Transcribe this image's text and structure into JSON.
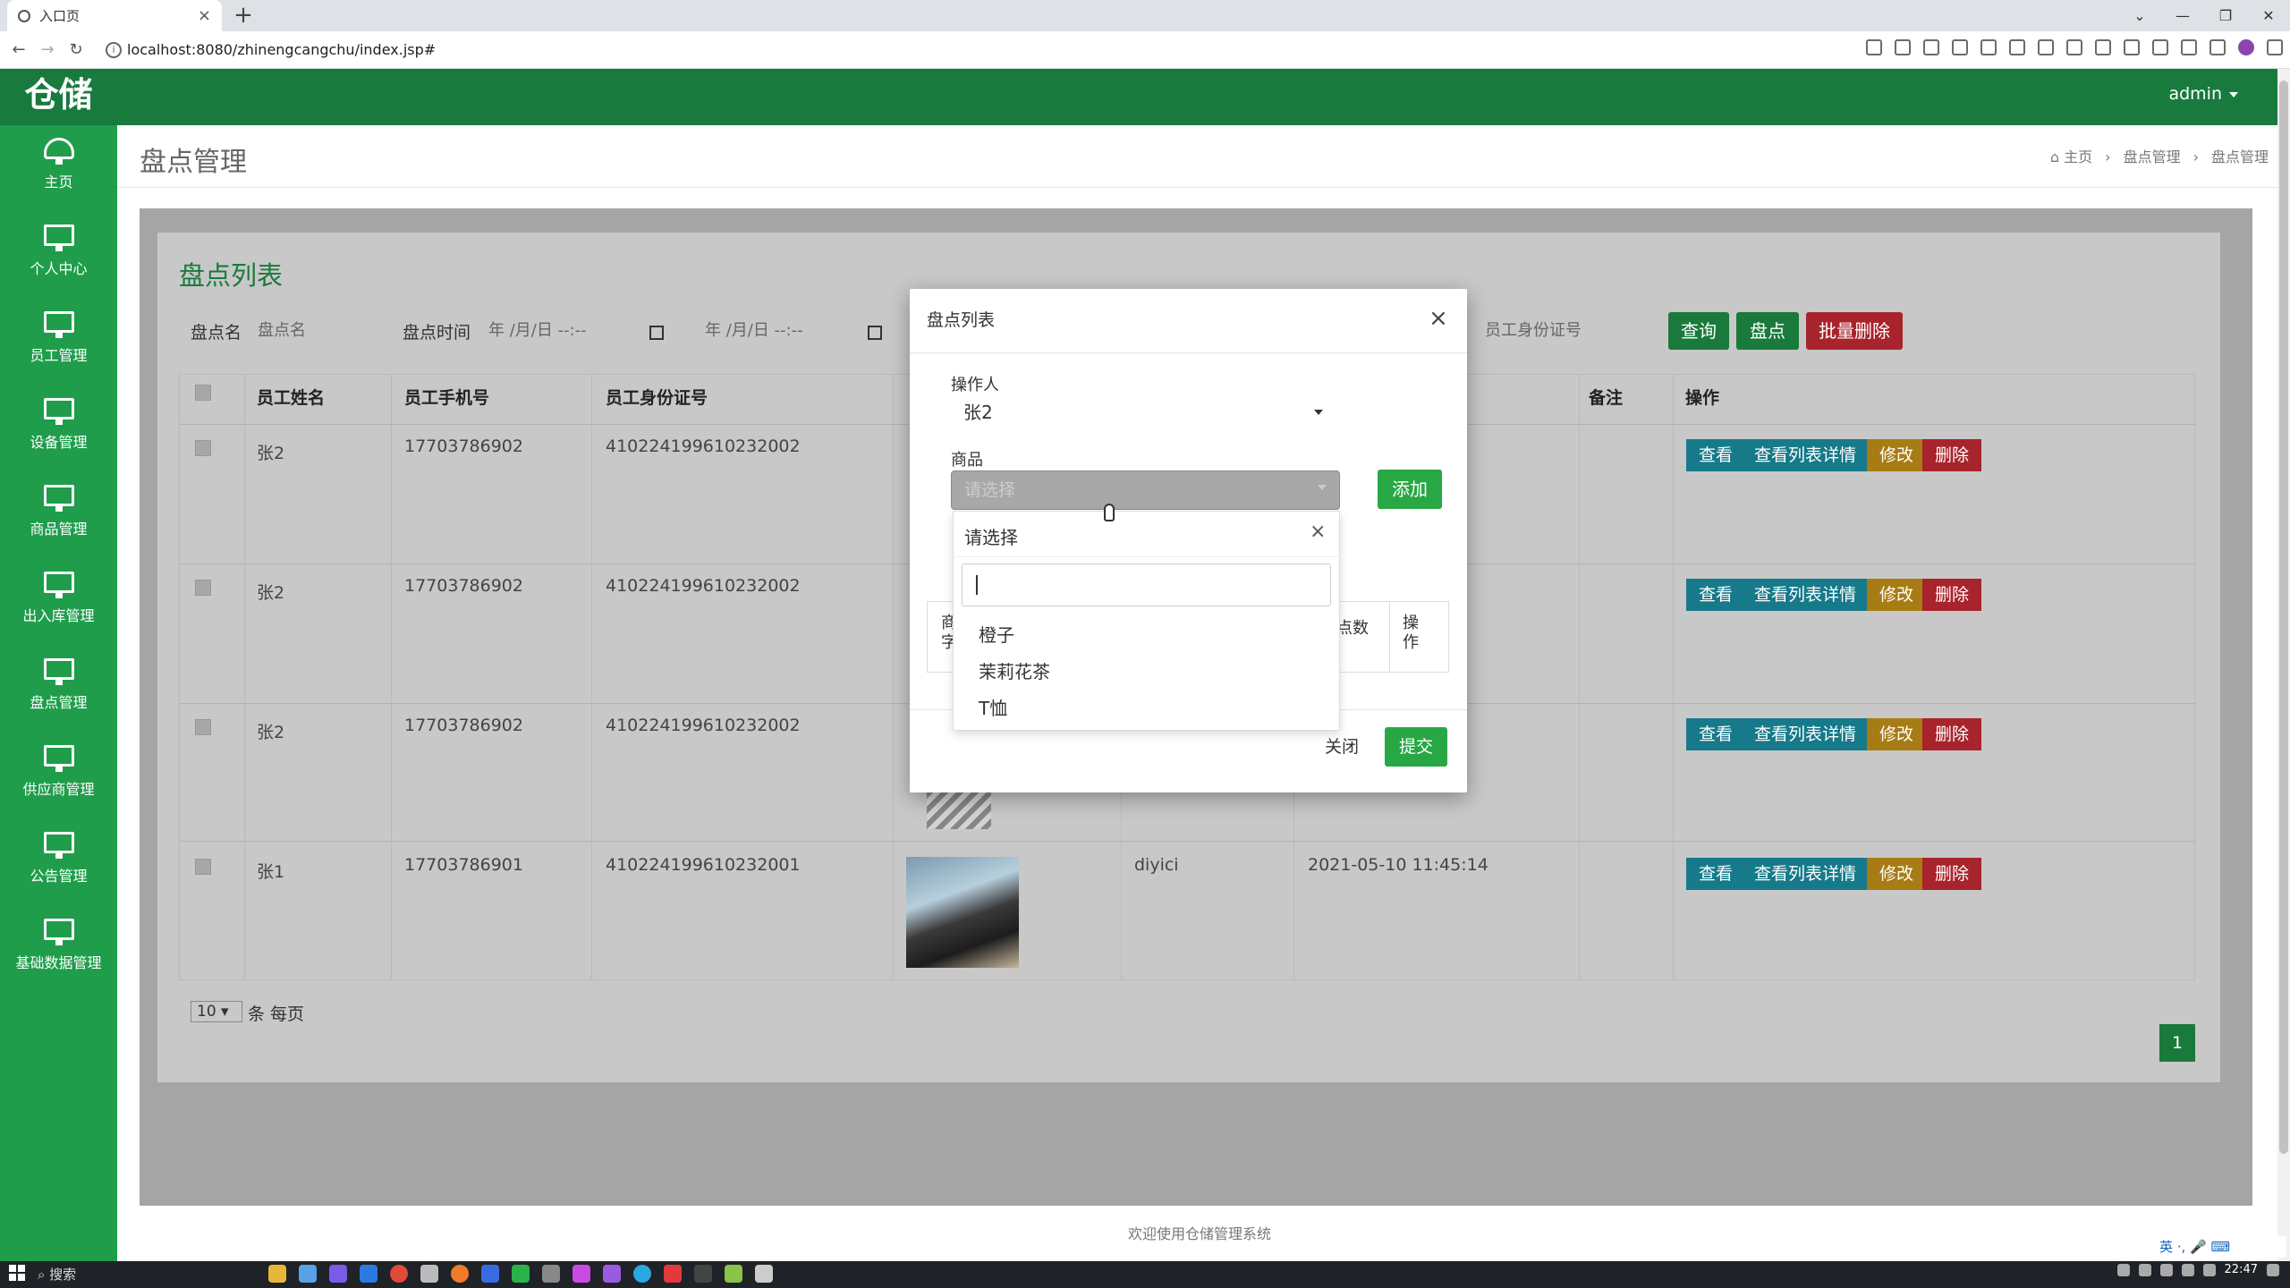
{
  "browser": {
    "tab_title": "入口页",
    "tab_close": "×",
    "new_tab": "+",
    "url": "localhost:8080/zhinengcangchu/index.jsp#",
    "window_controls": [
      "⌄",
      "—",
      "❐",
      "✕"
    ]
  },
  "app": {
    "logo": "仓储",
    "user": "admin",
    "theme": {
      "header": "#197a3e",
      "sidebar": "#1f9d4b",
      "accent": "#28a745",
      "danger": "#a8242c"
    }
  },
  "sidebar": {
    "items": [
      {
        "label": "主页",
        "icon": "dashboard-icon"
      },
      {
        "label": "个人中心",
        "icon": "monitor-icon"
      },
      {
        "label": "员工管理",
        "icon": "monitor-icon"
      },
      {
        "label": "设备管理",
        "icon": "monitor-icon"
      },
      {
        "label": "商品管理",
        "icon": "monitor-icon"
      },
      {
        "label": "出入库管理",
        "icon": "monitor-icon"
      },
      {
        "label": "盘点管理",
        "icon": "monitor-icon"
      },
      {
        "label": "供应商管理",
        "icon": "monitor-icon"
      },
      {
        "label": "公告管理",
        "icon": "monitor-icon"
      },
      {
        "label": "基础数据管理",
        "icon": "monitor-icon"
      }
    ]
  },
  "page": {
    "title": "盘点管理",
    "breadcrumb": [
      "主页",
      "盘点管理",
      "盘点管理"
    ]
  },
  "list": {
    "title": "盘点列表",
    "filters": {
      "name_label": "盘点名",
      "name_placeholder": "盘点名",
      "time_label": "盘点时间",
      "date_start": "年 /月/日 --:--",
      "date_end": "年 /月/日 --:--",
      "id_placeholder": "员工身份证号"
    },
    "buttons": {
      "search": "查询",
      "inventory": "盘点",
      "batch_delete": "批量删除"
    },
    "columns": [
      "员工姓名",
      "员工手机号",
      "员工身份证号",
      "备注",
      "操作"
    ],
    "rows": [
      {
        "name": "张2",
        "phone": "17703786902",
        "idcard": "410224199610232002",
        "title": "",
        "time": ""
      },
      {
        "name": "张2",
        "phone": "17703786902",
        "idcard": "410224199610232002",
        "title": "",
        "time": ""
      },
      {
        "name": "张2",
        "phone": "17703786902",
        "idcard": "410224199610232002",
        "title": "",
        "time": ""
      },
      {
        "name": "张1",
        "phone": "17703786901",
        "idcard": "410224199610232001",
        "title": "diyici",
        "time": "2021-05-10 11:45:14"
      }
    ],
    "row_actions": {
      "view": "查看",
      "detail": "查看列表详情",
      "edit": "修改",
      "delete": "删除"
    },
    "page_size": "10",
    "page_size_suffix": "条 每页",
    "current_page": "1"
  },
  "modal": {
    "title": "盘点列表",
    "close_x": "×",
    "operator_label": "操作人",
    "operator_value": "张2",
    "goods_label": "商品",
    "goods_placeholder": "请选择",
    "add_button": "添加",
    "inner_table": {
      "col1": "商品\n字",
      "col2": "点数",
      "col3": "操\n作"
    },
    "close_button": "关闭",
    "submit_button": "提交",
    "dropdown": {
      "header": "请选择",
      "clear": "×",
      "search_value": "",
      "options": [
        "橙子",
        "茉莉花茶",
        "T恤"
      ]
    }
  },
  "footer": {
    "text": "欢迎使用仓储管理系统"
  },
  "taskbar": {
    "search": "搜索",
    "clock": "22:47",
    "ime": "英 ·, 🎤 ⌨"
  }
}
